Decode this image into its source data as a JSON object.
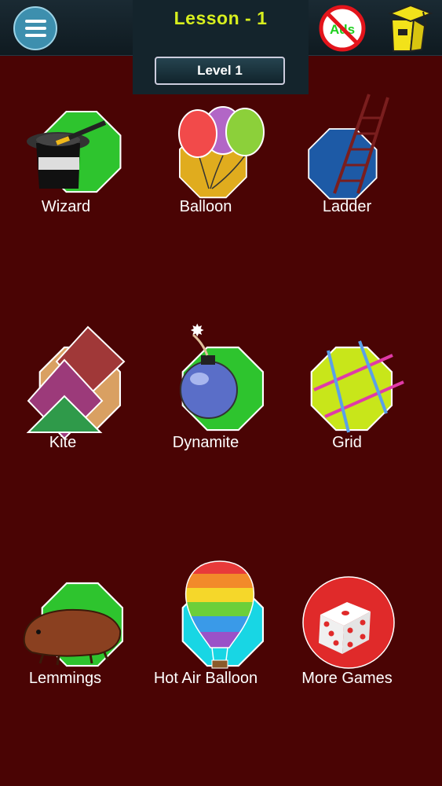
{
  "header": {
    "lesson_title": "Lesson - 1",
    "level_label": "Level 1",
    "ads_label": "Ads"
  },
  "icons": {
    "menu": "menu-icon",
    "no_ads": "no-ads-icon",
    "graduation": "graduation-cap-icon"
  },
  "games": [
    {
      "label": "Wizard",
      "icon": "wizard-hat-icon"
    },
    {
      "label": "Balloon",
      "icon": "balloons-icon"
    },
    {
      "label": "Ladder",
      "icon": "ladder-icon"
    },
    {
      "label": "Kite",
      "icon": "kites-icon"
    },
    {
      "label": "Dynamite",
      "icon": "bomb-icon"
    },
    {
      "label": "Grid",
      "icon": "grid-icon"
    },
    {
      "label": "Lemmings",
      "icon": "lemming-icon"
    },
    {
      "label": "Hot Air Balloon",
      "icon": "hot-air-balloon-icon"
    },
    {
      "label": "More Games",
      "icon": "dice-icon"
    }
  ],
  "colors": {
    "background": "#4a0404",
    "title_yellow": "#d8ef1e",
    "wizard_bg": "#2ec42e",
    "balloon_bg": "#e0ac1e",
    "ladder_bg": "#1d5aa6",
    "kite_bg": "#d9a062",
    "dynamite_bg": "#2ec42e",
    "grid_bg": "#c8e61a",
    "lemmings_bg": "#2ec42e",
    "hot_air_bg": "#18d6e4",
    "more_games_bg": "#e02a2a"
  }
}
